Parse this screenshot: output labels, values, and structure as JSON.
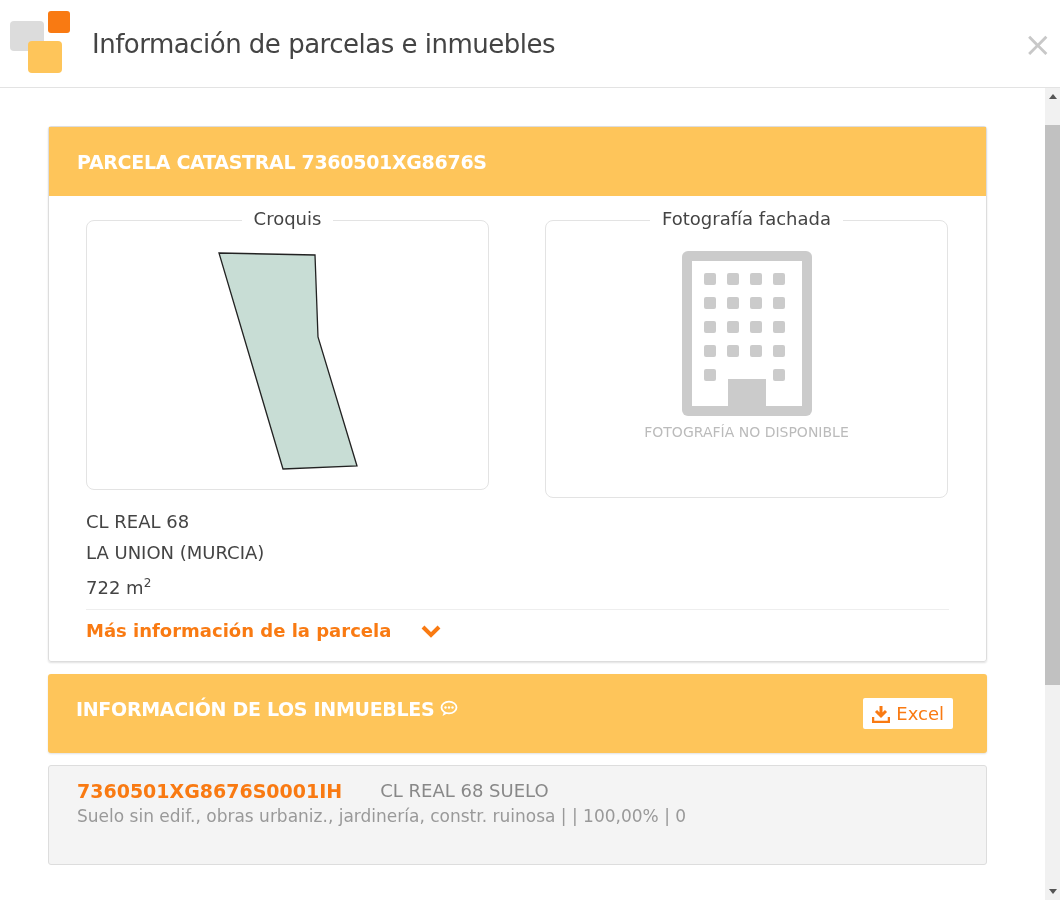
{
  "window": {
    "title": "Información de parcelas e inmuebles",
    "close": "×"
  },
  "parcel": {
    "title": "PARCELA CATASTRAL 7360501XG8676S",
    "sketch": {
      "label": "Croquis"
    },
    "photo": {
      "label": "Fotografía fachada",
      "placeholder": "FOTOGRAFÍA NO DISPONIBLE"
    },
    "address_lines": [
      "CL REAL 68",
      "LA UNION (MURCIA)",
      "722 m$^{2}$"
    ],
    "more_link": {
      "label": "Más información de la parcela",
      "expanded": false
    }
  },
  "properties": {
    "title": "INFORMACIÓN DE LOS INMUEBLES",
    "export_button": "Excel",
    "items": [
      {
        "reference": "7360501XG8676S0001IH",
        "address": "CL REAL 68 SUELO",
        "details": "Suelo sin edif., obras urbaniz., jardinería, constr. ruinosa | | 100,00% | 0"
      }
    ]
  }
}
